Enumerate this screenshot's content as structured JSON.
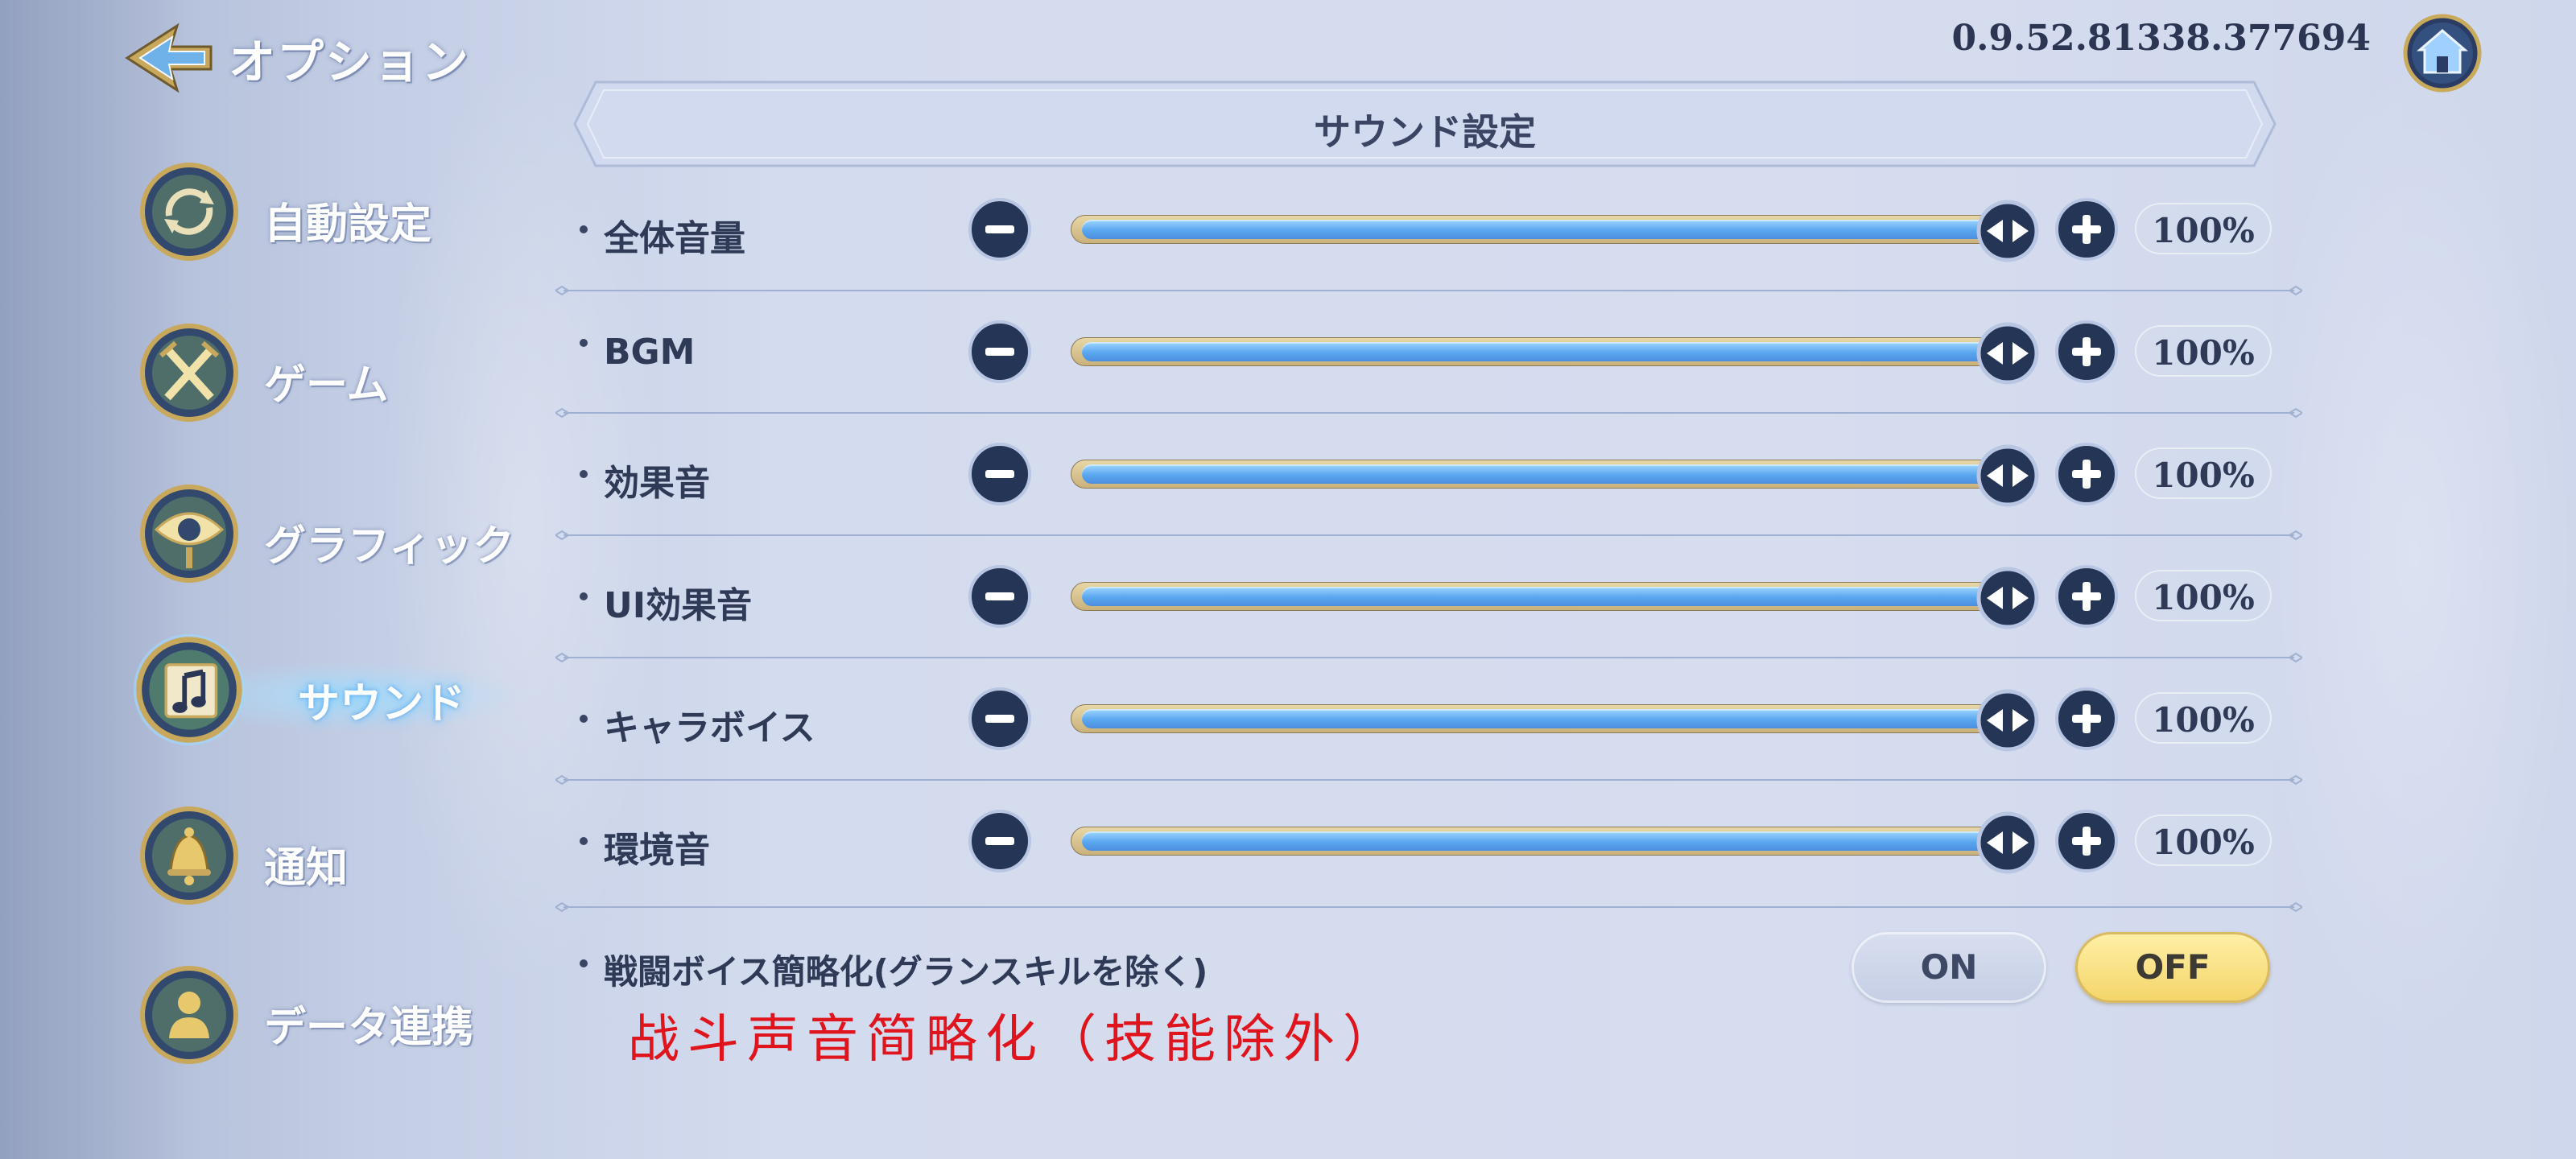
{
  "header": {
    "title": "オプション",
    "version": "0.9.52.81338.377694"
  },
  "sidebar": {
    "items": [
      {
        "label": "自動設定",
        "icon": "auto-settings-icon",
        "active": false
      },
      {
        "label": "ゲーム",
        "icon": "crossed-swords-icon",
        "active": false
      },
      {
        "label": "グラフィック",
        "icon": "eye-icon",
        "active": false
      },
      {
        "label": "サウンド",
        "icon": "music-note-icon",
        "active": true
      },
      {
        "label": "通知",
        "icon": "bell-icon",
        "active": false
      },
      {
        "label": "データ連携",
        "icon": "user-icon",
        "active": false
      }
    ]
  },
  "panel": {
    "title": "サウンド設定",
    "sliders": [
      {
        "label": "全体音量",
        "value": 100,
        "value_text": "100%"
      },
      {
        "label": "BGM",
        "value": 100,
        "value_text": "100%"
      },
      {
        "label": "効果音",
        "value": 100,
        "value_text": "100%"
      },
      {
        "label": "UI効果音",
        "value": 100,
        "value_text": "100%"
      },
      {
        "label": "キャラボイス",
        "value": 100,
        "value_text": "100%"
      },
      {
        "label": "環境音",
        "value": 100,
        "value_text": "100%"
      }
    ],
    "toggle": {
      "label": "戦闘ボイス簡略化(グランスキルを除く)",
      "on_label": "ON",
      "off_label": "OFF",
      "selected": "OFF"
    },
    "annotation": "战斗声音简略化（技能除外）"
  },
  "colors": {
    "accent_blue": "#5aa6f0",
    "button_navy": "#243556",
    "selected_yellow": "#f3d468",
    "annotation_red": "#e0141d"
  }
}
